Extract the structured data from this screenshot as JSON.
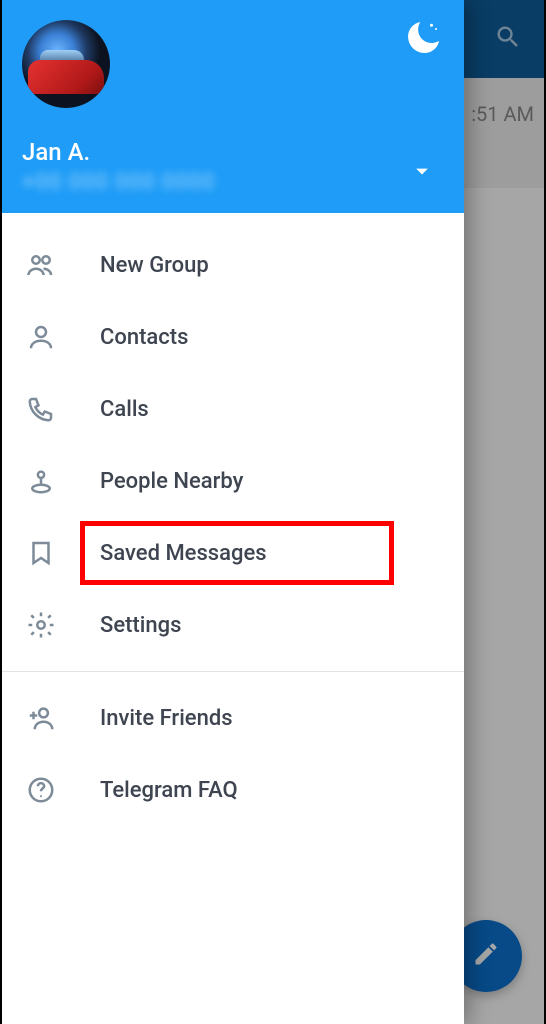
{
  "background": {
    "chat_time": ":51 AM"
  },
  "header": {
    "user_name": "Jan A.",
    "phone_placeholder": "+00 000 000 0000"
  },
  "menu": {
    "section1": [
      {
        "label": "New Group"
      },
      {
        "label": "Contacts"
      },
      {
        "label": "Calls"
      },
      {
        "label": "People Nearby"
      },
      {
        "label": "Saved Messages"
      },
      {
        "label": "Settings"
      }
    ],
    "section2": [
      {
        "label": "Invite Friends"
      },
      {
        "label": "Telegram FAQ"
      }
    ]
  },
  "highlighted_item": "Saved Messages"
}
